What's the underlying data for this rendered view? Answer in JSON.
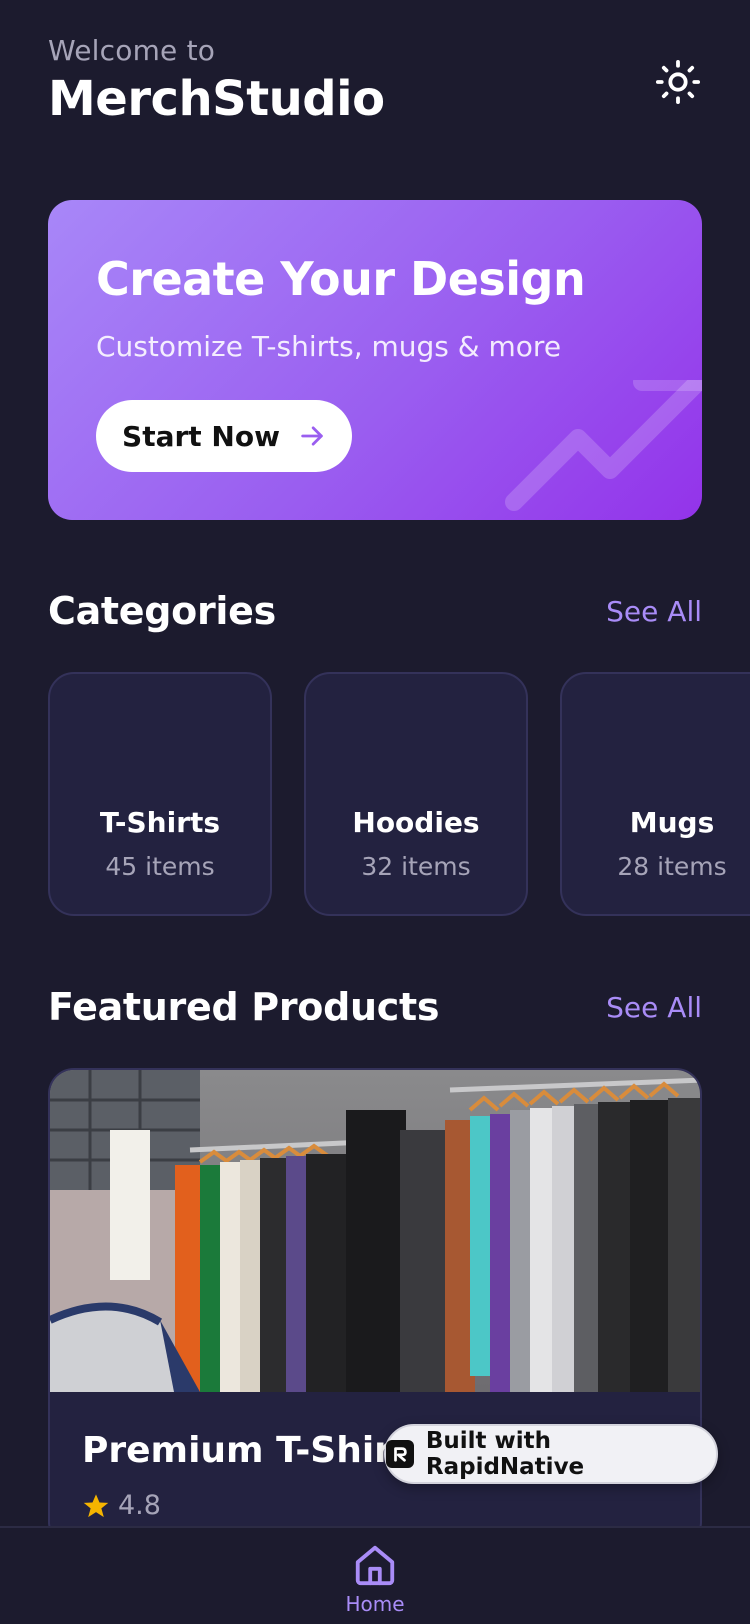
{
  "header": {
    "welcome": "Welcome to",
    "title": "MerchStudio",
    "theme_icon": "sun-icon"
  },
  "hero": {
    "title": "Create Your Design",
    "subtitle": "Customize T-shirts, mugs & more",
    "button_label": "Start Now",
    "button_icon": "arrow-right-icon",
    "decoration_icon": "trending-up-icon"
  },
  "categories": {
    "title": "Categories",
    "see_all": "See All",
    "items": [
      {
        "name": "T-Shirts",
        "count": "45 items"
      },
      {
        "name": "Hoodies",
        "count": "32 items"
      },
      {
        "name": "Mugs",
        "count": "28 items"
      }
    ]
  },
  "featured": {
    "title": "Featured Products",
    "see_all": "See All",
    "product": {
      "name": "Premium T-Shirt",
      "rating": "4.8",
      "image_alt": "clothes-rack-photo"
    }
  },
  "badge": {
    "label": "Built with RapidNative"
  },
  "tabbar": {
    "home_label": "Home"
  },
  "colors": {
    "background": "#1c1b2e",
    "card": "#232240",
    "accent": "#a98cf7",
    "hero_gradient_start": "#a887f8",
    "hero_gradient_end": "#9333ea",
    "star": "#f5b400"
  }
}
